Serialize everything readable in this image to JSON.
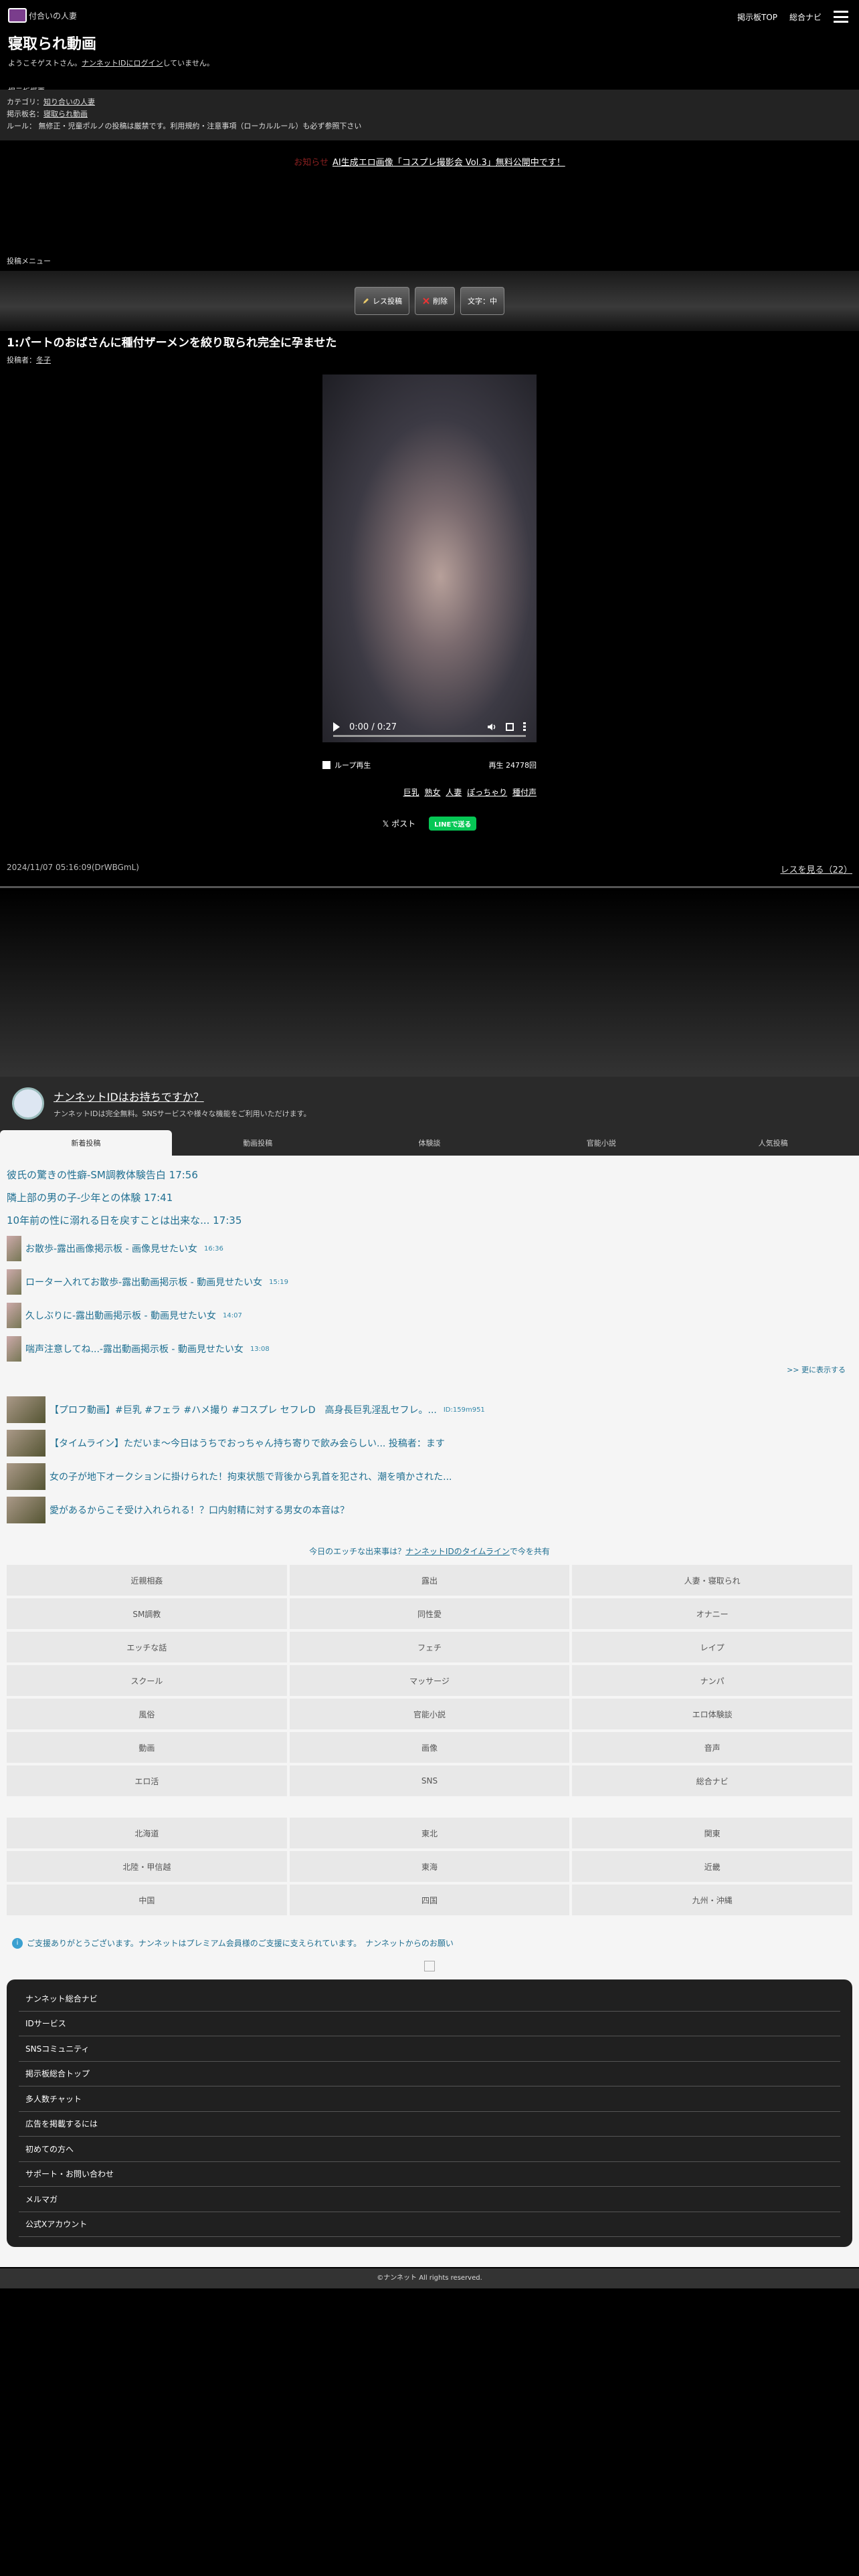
{
  "header": {
    "logo_text": "ナンネット|一般 付合い人妻",
    "logo_display": "付合いの人妻",
    "top_link": "掲示板TOP",
    "nav_link": "総合ナビ",
    "board_title": "寝取られ動画",
    "welcome_prefix": "ようこそゲストさん。",
    "welcome_link": "ナンネットIDにログイン",
    "welcome_suffix": "していません。",
    "section_label": "掲示板概要"
  },
  "info": {
    "category_label": "カテゴリ：",
    "category_value": "知り合いの人妻",
    "board_label": "掲示板名：",
    "board_value": "寝取られ動画",
    "rule_text": "ルール： 無修正・児童ポルノの投稿は厳禁です。利用規約・注意事項（ローカルルール）も必ず参照下さい"
  },
  "promo": {
    "tag": "お知らせ",
    "text": "AI生成エロ画像「コスプレ撮影会 Vol.3」無料公開中です！"
  },
  "post_menu_label": "投稿メニュー",
  "toolbar": {
    "reply": "レス投稿",
    "delete": "削除",
    "font": "文字：中"
  },
  "post": {
    "title": "1:パートのおばさんに種付ザーメンを絞り取られ完全に孕ませた",
    "poster_label": "投稿者：",
    "poster_name": "冬子",
    "video_time": "0:00 / 0:27",
    "loop_label": "ループ再生",
    "play_count": "再生 24778回",
    "tags": [
      "巨乳",
      "熟女",
      "人妻",
      "ぽっちゃり",
      "種付声"
    ],
    "share_x": "ポスト",
    "share_line": "LINEで送る",
    "date": "2024/11/07 05:16:09(DrWBGmL)",
    "res_link": "レスを見る（22）"
  },
  "nanid": {
    "title": "ナンネットIDはお持ちですか？",
    "sub": "ナンネットIDは完全無料。SNSサービスや様々な機能をご利用いただけます。"
  },
  "tabs": [
    "新着投稿",
    "動画投稿",
    "体験談",
    "官能小説",
    "人気投稿"
  ],
  "news": [
    {
      "text": "彼氏の驚きの性癖-SM調教体験告白 17:56"
    },
    {
      "text": "隣上部の男の子-少年との体験 17:41"
    },
    {
      "text": "10年前の性に溺れる日を戻すことは出来な... 17:35"
    }
  ],
  "thumb_news": [
    {
      "text": "お散歩-露出画像掲示板 - 画像見せたい女",
      "time": "16:36"
    },
    {
      "text": "ローター入れてお散歩-露出動画掲示板 - 動画見せたい女",
      "time": "15:19"
    },
    {
      "text": "久しぶりに-露出動画掲示板 - 動画見せたい女",
      "time": "14:07"
    },
    {
      "text": "喘声注意してね...-露出動画掲示板 - 動画見せたい女",
      "time": "13:08"
    }
  ],
  "more_link": ">> 更に表示する",
  "featured": [
    {
      "text": "【プロフ動画】#巨乳 #フェラ #ハメ撮り #コスプレ セフレD　高身長巨乳淫乱セフレ。...",
      "id": "ID:159m951"
    },
    {
      "text": "【タイムライン】ただいま〜今日はうちでおっちゃん持ち寄りで飲み会らしい... 投稿者：ます"
    },
    {
      "text": "女の子が地下オークションに掛けられた！拘束状態で背後から乳首を犯され、潮を噴かされた..."
    },
    {
      "text": "愛があるからこそ受け入れられる！？口内射精に対する男女の本音は？"
    }
  ],
  "tagline_prefix": "今日のエッチな出来事は？",
  "tagline_link": "ナンネットIDのタイムライン",
  "tagline_suffix": "で今を共有",
  "categories": [
    "近親相姦",
    "露出",
    "人妻・寝取られ",
    "SM調教",
    "同性愛",
    "オナニー",
    "エッチな話",
    "フェチ",
    "レイプ",
    "スクール",
    "マッサージ",
    "ナンパ",
    "風俗",
    "官能小説",
    "エロ体験談",
    "動画",
    "画像",
    "音声",
    "エロ活",
    "SNS",
    "総合ナビ"
  ],
  "regions": [
    "北海道",
    "東北",
    "関東",
    "北陸・甲信越",
    "東海",
    "近畿",
    "中国",
    "四国",
    "九州・沖縄"
  ],
  "notice": {
    "text": "ご支援ありがとうございます。ナンネットはプレミアム会員様のご支援に支えられています。",
    "link": "ナンネットからのお願い"
  },
  "footer_menu": [
    "ナンネット総合ナビ",
    "IDサービス",
    "SNSコミュニティ",
    "掲示板総合トップ",
    "多人数チャット",
    "広告を掲載するには",
    "初めての方へ",
    "サポート・お問い合わせ",
    "メルマガ",
    "公式Xアカウント"
  ],
  "copyright": "©ナンネット All rights reserved."
}
